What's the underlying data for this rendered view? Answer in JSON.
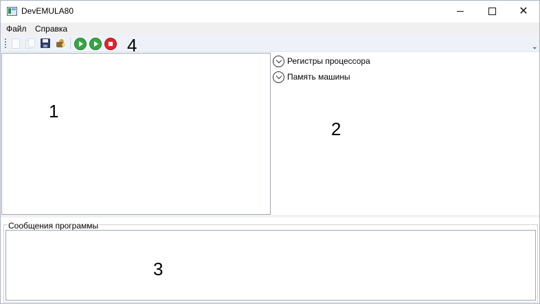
{
  "window": {
    "title": "DevEMULA80",
    "controls": {
      "minimize": "minimize",
      "maximize": "maximize",
      "close": "✕"
    }
  },
  "menu": {
    "file": "Файл",
    "help": "Справка"
  },
  "toolbar": {
    "icons": [
      "new-document-icon",
      "open-icon",
      "save-icon",
      "build-icon",
      "run-icon",
      "step-icon",
      "stop-icon"
    ],
    "overflow": "⏷",
    "annotation": "4"
  },
  "panels": {
    "editor": {
      "annotation": "1"
    },
    "right": {
      "annotation": "2",
      "expanders": [
        {
          "label": "Регистры процессора"
        },
        {
          "label": "Память машины"
        }
      ]
    },
    "messages": {
      "title": "Сообщения программы",
      "annotation": "3"
    }
  },
  "colors": {
    "window_border": "#aab4c2",
    "toolbar_bg": "#eef2f8",
    "menubar_bg": "#f0f0f0",
    "run_green": "#37a642",
    "stop_red": "#e3242b"
  }
}
